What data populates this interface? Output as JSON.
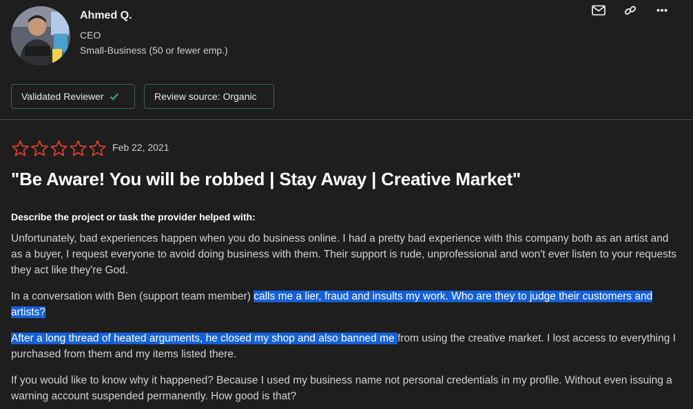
{
  "reviewer": {
    "name": "Ahmed Q.",
    "title": "CEO",
    "company_size": "Small-Business (50 or fewer emp.)"
  },
  "header_actions": {
    "icons": [
      "mail-icon",
      "link-icon",
      "more-icon"
    ]
  },
  "badges": {
    "validated": "Validated Reviewer",
    "source": "Review source: Organic"
  },
  "rating": {
    "stars": 0,
    "max": 5
  },
  "review": {
    "date": "Feb 22, 2021",
    "title": "\"Be Aware! You will be robbed | Stay Away | Creative Market\"",
    "question": "Describe the project or task the provider helped with:",
    "p1": "Unfortunately, bad experiences happen when you do business online. I had a pretty bad experience with this company both as an artist and as a buyer, I request everyone to avoid doing business with them. Their support is rude, unprofessional and won't ever listen to your requests they act like they're God.",
    "p2_plain": "In a conversation with Ben (support team member) ",
    "p2_highlight": "calls me a lier, fraud and insults my work. Who are they to judge their customers and artists?",
    "p3_highlight": "After a long thread of heated arguments, he closed my shop and also banned me ",
    "p3_plain": "from using the creative market. I lost access to everything I purchased from them and my items listed there.",
    "p4": "If you would like to know why it happened? Because I used my business name not personal credentials in my profile. Without even issuing a warning account suspended permanently. How good is that?"
  },
  "colors": {
    "background": "#1e1e1e",
    "star_outline": "#e0402f",
    "badge_border": "#2e6b55",
    "check": "#3fa97a",
    "highlight": "#1560d6"
  }
}
